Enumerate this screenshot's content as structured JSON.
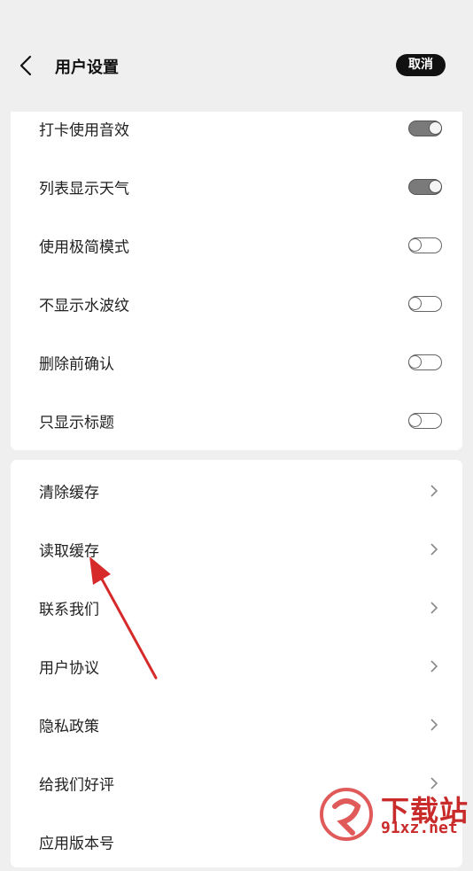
{
  "header": {
    "back_icon": "chevron-left-icon",
    "title": "用户设置",
    "cancel_label": "取消"
  },
  "toggles": [
    {
      "label": "打卡使用音效",
      "on": true
    },
    {
      "label": "列表显示天气",
      "on": true
    },
    {
      "label": "使用极简模式",
      "on": false
    },
    {
      "label": "不显示水波纹",
      "on": false
    },
    {
      "label": "删除前确认",
      "on": false
    },
    {
      "label": "只显示标题",
      "on": false
    }
  ],
  "links": [
    {
      "label": "清除缓存",
      "icon": "chevron-right-icon"
    },
    {
      "label": "读取缓存",
      "icon": "chevron-right-icon"
    },
    {
      "label": "联系我们",
      "icon": "chevron-right-icon"
    },
    {
      "label": "用户协议",
      "icon": "chevron-right-icon"
    },
    {
      "label": "隐私政策",
      "icon": "chevron-right-icon"
    },
    {
      "label": "给我们好评",
      "icon": "chevron-right-icon"
    },
    {
      "label": "应用版本号",
      "icon": ""
    }
  ],
  "annotation": {
    "type": "red-arrow",
    "color": "#d62a2a",
    "points_to": "读取缓存"
  },
  "watermark": {
    "title": "下载站",
    "url": "91xz.net",
    "color": "#c92b2b"
  }
}
